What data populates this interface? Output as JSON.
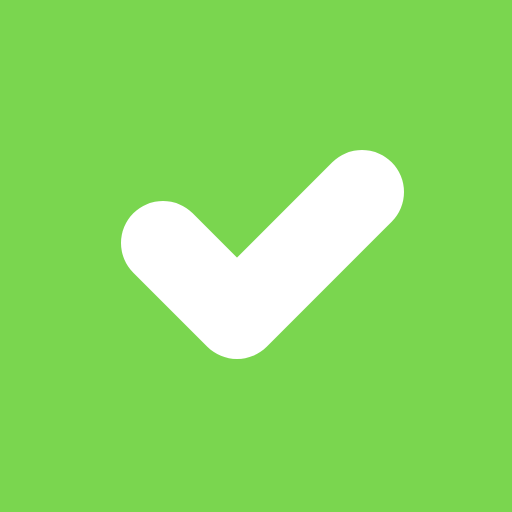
{
  "icon": {
    "name": "checkmark-icon",
    "background_color": "#7ad64f",
    "mark_color": "#ffffff"
  }
}
